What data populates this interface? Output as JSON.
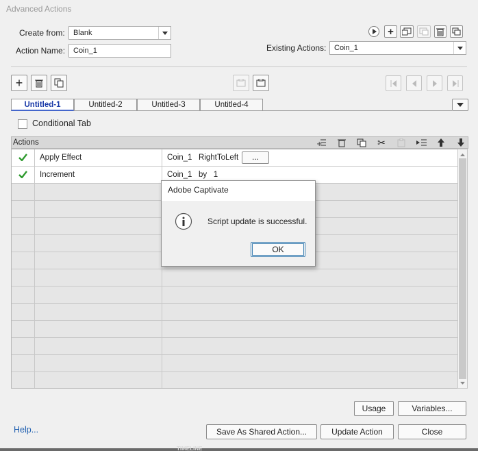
{
  "window": {
    "title": "Advanced Actions"
  },
  "form": {
    "create_from_label": "Create from:",
    "create_from_value": "Blank",
    "action_name_label": "Action Name:",
    "action_name_value": "Coin_1",
    "existing_actions_label": "Existing Actions:",
    "existing_actions_value": "Coin_1"
  },
  "tabs": [
    {
      "label": "Untitled-1",
      "active": true
    },
    {
      "label": "Untitled-2",
      "active": false
    },
    {
      "label": "Untitled-3",
      "active": false
    },
    {
      "label": "Untitled-4",
      "active": false
    }
  ],
  "conditional_tab_label": "Conditional Tab",
  "actions_panel": {
    "header": "Actions",
    "rows": [
      {
        "action": "Apply Effect",
        "args": "Coin_1   RightToLeft",
        "has_more": true,
        "more_label": "..."
      },
      {
        "action": "Increment",
        "args": "Coin_1   by   1",
        "has_more": false
      }
    ],
    "empty_rows": 12
  },
  "dialog": {
    "title": "Adobe Captivate",
    "message": "Script update is successful.",
    "ok_label": "OK",
    "icon": "info-icon"
  },
  "buttons": {
    "usage": "Usage",
    "variables": "Variables...",
    "help": "Help...",
    "save_shared": "Save As Shared Action...",
    "update": "Update Action",
    "close": "Close"
  },
  "footer_cut_text": "TIMELINE",
  "colors": {
    "active_tab": "#1a3aa8",
    "check": "#2e9a2e",
    "help_link": "#1f5fb0"
  }
}
